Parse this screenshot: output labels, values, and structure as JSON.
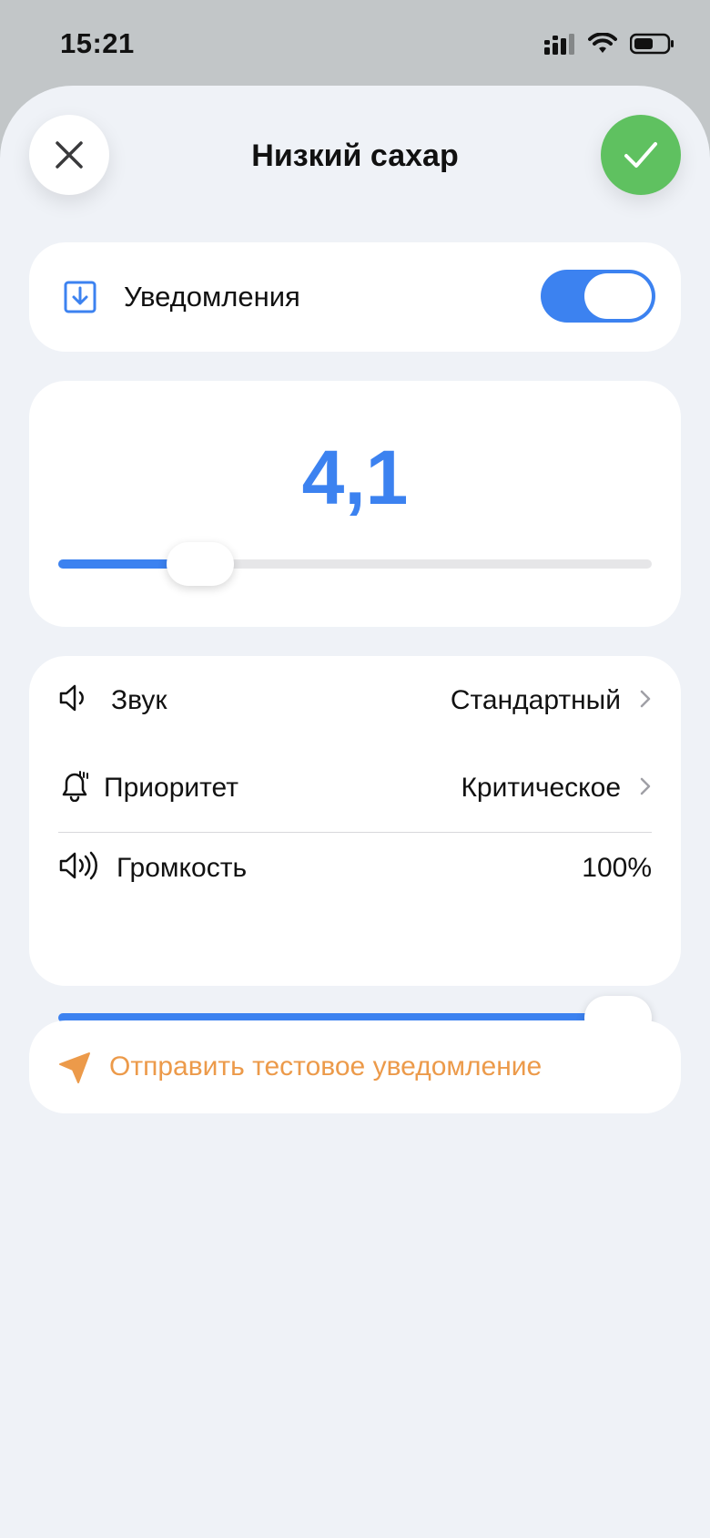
{
  "status_bar": {
    "time": "15:21"
  },
  "header": {
    "title": "Низкий сахар",
    "close_icon": "close-icon",
    "confirm_icon": "checkmark-icon"
  },
  "notifications": {
    "label": "Уведомления",
    "enabled": true,
    "icon": "download-square-icon"
  },
  "threshold": {
    "value": "4,1",
    "slider_fraction": 0.24
  },
  "settings": {
    "sound": {
      "label": "Звук",
      "value": "Стандартный",
      "icon": "speaker-icon"
    },
    "priority": {
      "label": "Приоритет",
      "value": "Критическое",
      "icon": "bell-alert-icon"
    },
    "volume": {
      "label": "Громкость",
      "value": "100%",
      "icon": "speaker-loud-icon",
      "fraction": 1.0
    }
  },
  "test_notification": {
    "label": "Отправить тестовое уведомление",
    "icon": "paper-plane-icon"
  },
  "colors": {
    "accent_blue": "#3c82f0",
    "confirm_green": "#5fc160",
    "test_orange": "#ec9a4a",
    "sheet_bg": "#eff2f7"
  }
}
